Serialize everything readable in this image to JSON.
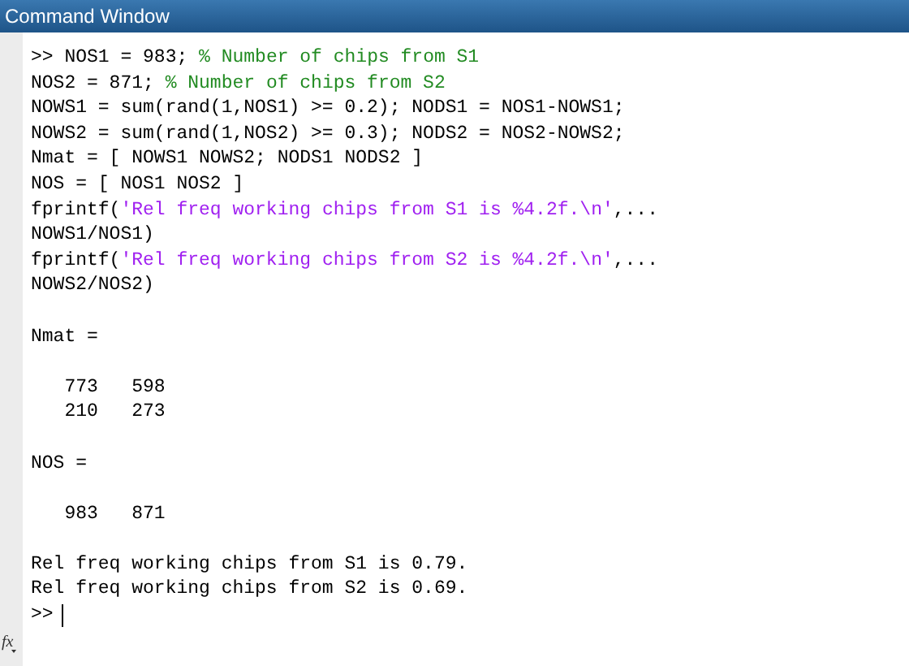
{
  "window": {
    "title": "Command Window"
  },
  "commands": [
    [
      {
        "kind": "prompt",
        "text": ">> "
      },
      {
        "kind": "code",
        "text": "NOS1 = 983; "
      },
      {
        "kind": "comment",
        "text": "% Number of chips from S1"
      }
    ],
    [
      {
        "kind": "code",
        "text": "NOS2 = 871; "
      },
      {
        "kind": "comment",
        "text": "% Number of chips from S2"
      }
    ],
    [
      {
        "kind": "code",
        "text": "NOWS1 = sum(rand(1,NOS1) >= 0.2); NODS1 = NOS1-NOWS1;"
      }
    ],
    [
      {
        "kind": "code",
        "text": "NOWS2 = sum(rand(1,NOS2) >= 0.3); NODS2 = NOS2-NOWS2;"
      }
    ],
    [
      {
        "kind": "code",
        "text": "Nmat = [ NOWS1 NOWS2; NODS1 NODS2 ]"
      }
    ],
    [
      {
        "kind": "code",
        "text": "NOS = [ NOS1 NOS2 ]"
      }
    ],
    [
      {
        "kind": "code",
        "text": "fprintf("
      },
      {
        "kind": "string",
        "text": "'Rel freq working chips from S1 is %4.2f.\\n'"
      },
      {
        "kind": "code",
        "text": ",..."
      }
    ],
    [
      {
        "kind": "code",
        "text": "NOWS1/NOS1)"
      }
    ],
    [
      {
        "kind": "code",
        "text": "fprintf("
      },
      {
        "kind": "string",
        "text": "'Rel freq working chips from S2 is %4.2f.\\n'"
      },
      {
        "kind": "code",
        "text": ",..."
      }
    ],
    [
      {
        "kind": "code",
        "text": "NOWS2/NOS2)"
      }
    ]
  ],
  "outputs": [
    {
      "kind": "variable",
      "name": "Nmat =",
      "rows": [
        [
          "773",
          "598"
        ],
        [
          "210",
          "273"
        ]
      ]
    },
    {
      "kind": "variable",
      "name": "NOS =",
      "rows": [
        [
          "983",
          "871"
        ]
      ]
    },
    {
      "kind": "text",
      "lines": [
        "Rel freq working chips from S1 is 0.79.",
        "Rel freq working chips from S2 is 0.69."
      ]
    }
  ],
  "prompt": ">>",
  "function_button": "fx"
}
